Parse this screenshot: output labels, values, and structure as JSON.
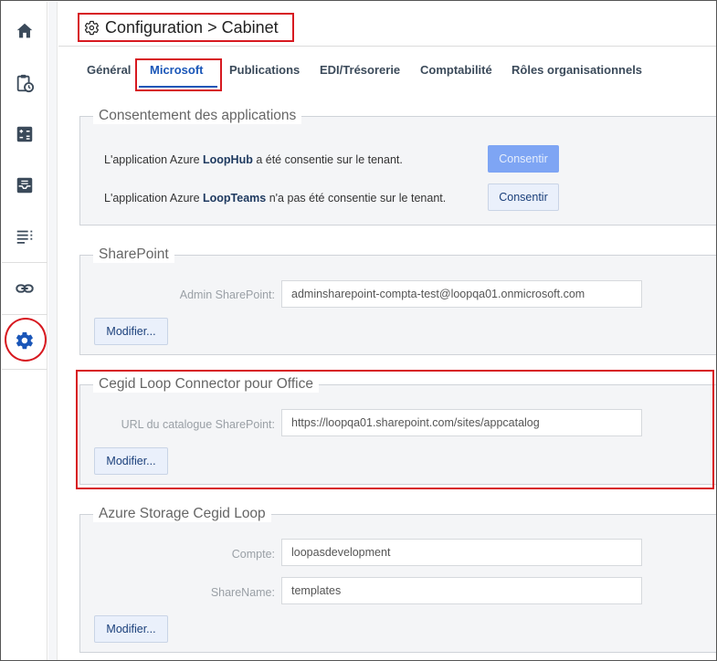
{
  "header": {
    "title": "Configuration > Cabinet"
  },
  "sidebar": {
    "items": [
      {
        "icon": "home-icon"
      },
      {
        "icon": "clipboard-clock-icon"
      },
      {
        "icon": "calculator-icon"
      },
      {
        "icon": "inbox-tray-icon"
      },
      {
        "icon": "list-icon"
      },
      {
        "icon": "link-icon"
      },
      {
        "icon": "gear-icon",
        "active": true
      }
    ]
  },
  "tabs": [
    {
      "label": "Général"
    },
    {
      "label": "Microsoft",
      "active": true
    },
    {
      "label": "Publications"
    },
    {
      "label": "EDI/Trésorerie"
    },
    {
      "label": "Comptabilité"
    },
    {
      "label": "Rôles organisationnels"
    }
  ],
  "consent": {
    "legend": "Consentement des applications",
    "row1_prefix": "L'application Azure ",
    "row1_app": "LoopHub",
    "row1_suffix": " a été consentie sur le tenant.",
    "row1_button": "Consentir",
    "row2_prefix": "L'application Azure ",
    "row2_app": "LoopTeams",
    "row2_suffix": " n'a pas été consentie sur le tenant.",
    "row2_button": "Consentir"
  },
  "sharepoint": {
    "legend": "SharePoint",
    "admin_label": "Admin SharePoint:",
    "admin_value": "adminsharepoint-compta-test@loopqa01.onmicrosoft.com",
    "modify_button": "Modifier..."
  },
  "connector": {
    "legend": "Cegid Loop Connector pour Office",
    "url_label": "URL du catalogue SharePoint:",
    "url_value": "https://loopqa01.sharepoint.com/sites/appcatalog",
    "modify_button": "Modifier..."
  },
  "storage": {
    "legend": "Azure Storage Cegid Loop",
    "account_label": "Compte:",
    "account_value": "loopasdevelopment",
    "share_label": "ShareName:",
    "share_value": "templates",
    "modify_button": "Modifier..."
  },
  "colors": {
    "accent": "#1a56b8",
    "highlight": "#d71920",
    "icon": "#3b4a5a"
  }
}
